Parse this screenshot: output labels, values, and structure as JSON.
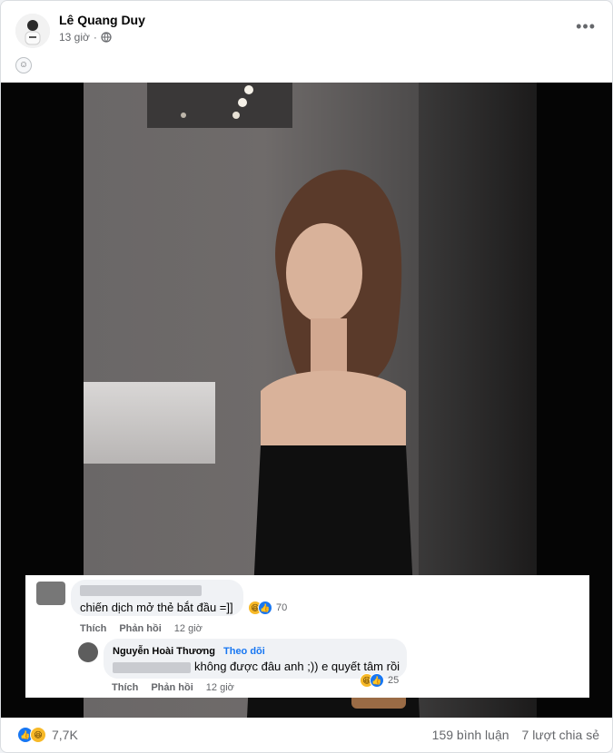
{
  "post": {
    "author": "Lê Quang Duy",
    "time": "13 giờ",
    "privacy_icon": "globe-icon",
    "status_icon": "face-emoji-icon",
    "more_label": "•••"
  },
  "comments": [
    {
      "text": "chiến dịch mở thẻ bắt đầu =]]",
      "reaction_count": "70",
      "like_label": "Thích",
      "reply_label": "Phản hồi",
      "time": "12 giờ"
    },
    {
      "author": "Nguyễn Hoài Thương",
      "follow_label": "Theo dõi",
      "text": "không được đâu anh ;)) e quyết tâm rồi",
      "reaction_count": "25",
      "like_label": "Thích",
      "reply_label": "Phản hồi",
      "time": "12 giờ"
    }
  ],
  "footer": {
    "reaction_count": "7,7K",
    "comments_label": "159 bình luận",
    "shares_label": "7 lượt chia sẻ"
  },
  "colors": {
    "accent": "#1877f2",
    "haha": "#f7b928",
    "text_secondary": "#65676b"
  }
}
